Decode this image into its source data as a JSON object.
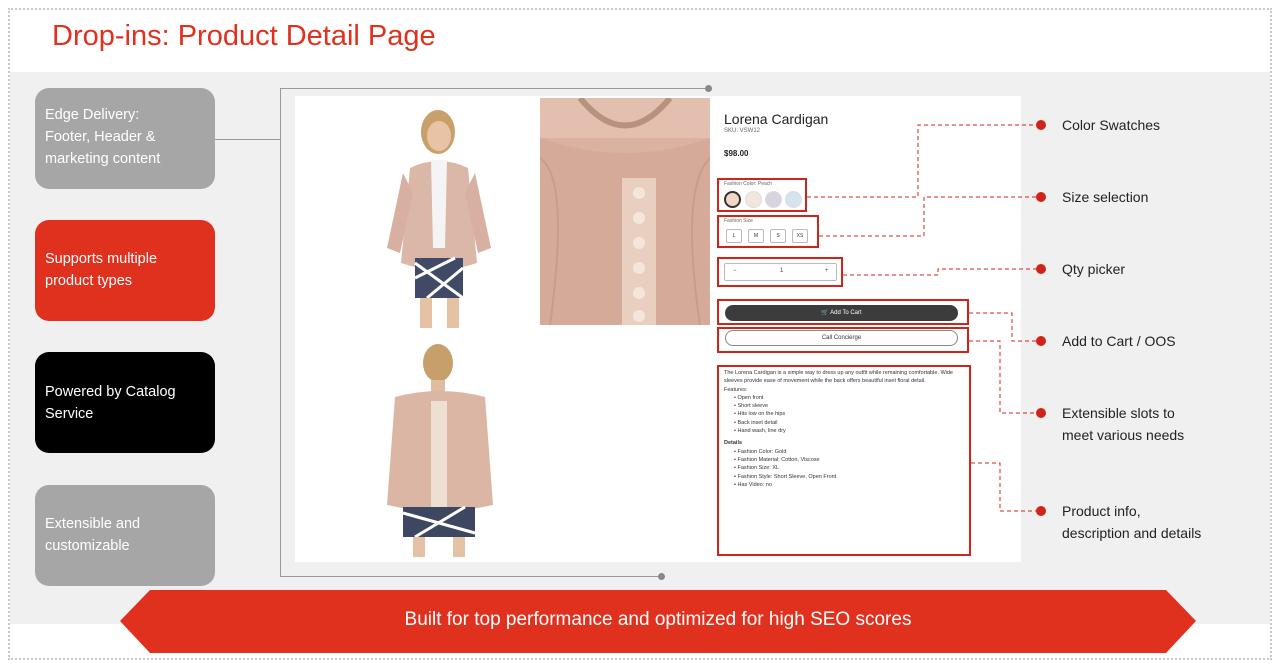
{
  "page_title": "Drop-ins: Product Detail Page",
  "left_pills": [
    {
      "lines": [
        "Edge Delivery:",
        "Footer, Header &",
        "marketing content"
      ],
      "color": "#a6a6a6"
    },
    {
      "lines": [
        "Supports multiple",
        "product types"
      ],
      "color": "#e0301e"
    },
    {
      "lines": [
        "Powered by Catalog",
        "Service"
      ],
      "color": "#000000"
    },
    {
      "lines": [
        "Extensible and",
        "customizable"
      ],
      "color": "#a6a6a6"
    }
  ],
  "product": {
    "name": "Lorena Cardigan",
    "sku": "SKU: VSW12",
    "price": "$98.00",
    "color_label": "Fashion Color: Peach",
    "swatch_colors": [
      "#f3d7c6",
      "#f1e6dc",
      "#d9d3df",
      "#d4e3ee"
    ],
    "size_label": "Fashion Size",
    "sizes": [
      "L",
      "M",
      "S",
      "XS"
    ],
    "qty_minus": "−",
    "qty_value": "1",
    "qty_plus": "+",
    "add_to_cart": "Add To Cart",
    "call_concierge": "Call Concierge",
    "description": "The Lorena Cardigan is a simple way to dress up any outfit while remaining comfortable. Wide sleeves provide ease of movement while the back offers beautiful inset floral detail.",
    "features_label": "Features:",
    "features": [
      "Open front",
      "Short sleeve",
      "Hits low on the hips",
      "Back inset detail",
      "Hand wash, line dry"
    ],
    "details_label": "Details",
    "details": [
      "Fashion Color: Gold",
      "Fashion Material: Cotton, Viscose",
      "Fashion Size: XL",
      "Fashion Style: Short Sleeve, Open Front",
      "Has Video: no"
    ]
  },
  "callouts": [
    {
      "lines": [
        "Color Swatches"
      ]
    },
    {
      "lines": [
        "Size selection"
      ]
    },
    {
      "lines": [
        "Qty picker"
      ]
    },
    {
      "lines": [
        "Add to Cart / OOS"
      ]
    },
    {
      "lines": [
        "Extensible slots to",
        "meet various needs"
      ]
    },
    {
      "lines": [
        "Product info,",
        "description and details"
      ]
    }
  ],
  "banner_text": "Built for top performance and optimized for high SEO scores",
  "accent_color": "#e0301e",
  "callout_color": "#d0241b"
}
